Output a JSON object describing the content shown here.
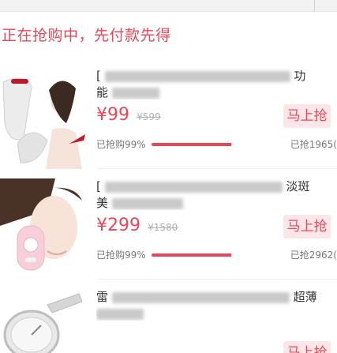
{
  "notice": "正在抢购中，先付款先得",
  "items": [
    {
      "title_visible": "[",
      "title_tail": "功",
      "title_line2_visible": "能",
      "price": "¥99",
      "orig_price": "¥599",
      "buy_label": "马上抢",
      "progress_text": "已抢购99%",
      "progress": 0.99,
      "sold_text": "已抢1965("
    },
    {
      "title_visible": "[",
      "title_tail": "淡斑",
      "title_line2_visible": "美",
      "price": "¥299",
      "orig_price": "¥1580",
      "buy_label": "马上抢",
      "progress_text": "已抢购99%",
      "progress": 0.99,
      "sold_text": "已抢2962("
    },
    {
      "title_visible": "雷",
      "title_tail": "超薄",
      "title_line2_visible": "",
      "price": "",
      "orig_price": "",
      "buy_label": "马上抢",
      "progress_text": "",
      "progress": 0,
      "sold_text": ""
    }
  ]
}
